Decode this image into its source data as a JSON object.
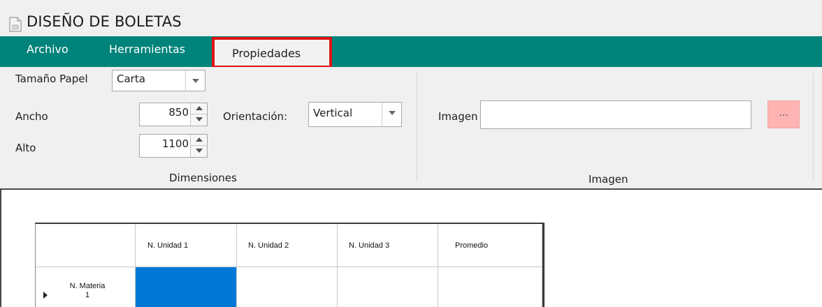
{
  "window": {
    "title": "DISEÑO DE BOLETAS",
    "icon": "document-icon"
  },
  "menu": {
    "items": [
      {
        "label": "Archivo"
      },
      {
        "label": "Herramientas"
      },
      {
        "label": "Propiedades",
        "active": true,
        "highlight_color": "#e01414"
      }
    ],
    "background": "#00837a"
  },
  "ribbon": {
    "dimensiones": {
      "group_label": "Dimensiones",
      "paper_size_label": "Tamaño Papel",
      "paper_size_value": "Carta",
      "width_label": "Ancho",
      "width_value": "850",
      "height_label": "Alto",
      "height_value": "1100",
      "orientation_label": "Orientación:",
      "orientation_value": "Vertical"
    },
    "imagen": {
      "group_label": "Imagen",
      "image_label": "Imagen",
      "image_value": "",
      "browse_label": "...",
      "browse_color": "#ffb3b3"
    }
  },
  "grid": {
    "columns": [
      "",
      "N. Unidad 1",
      "N. Unidad 2",
      "N. Unidad 3",
      "Promedio"
    ],
    "rows": [
      {
        "header": "N. Materia\n1",
        "cells": [
          "",
          "",
          "",
          ""
        ],
        "selected_cell": 0
      }
    ],
    "selection_color": "#0078d7"
  }
}
